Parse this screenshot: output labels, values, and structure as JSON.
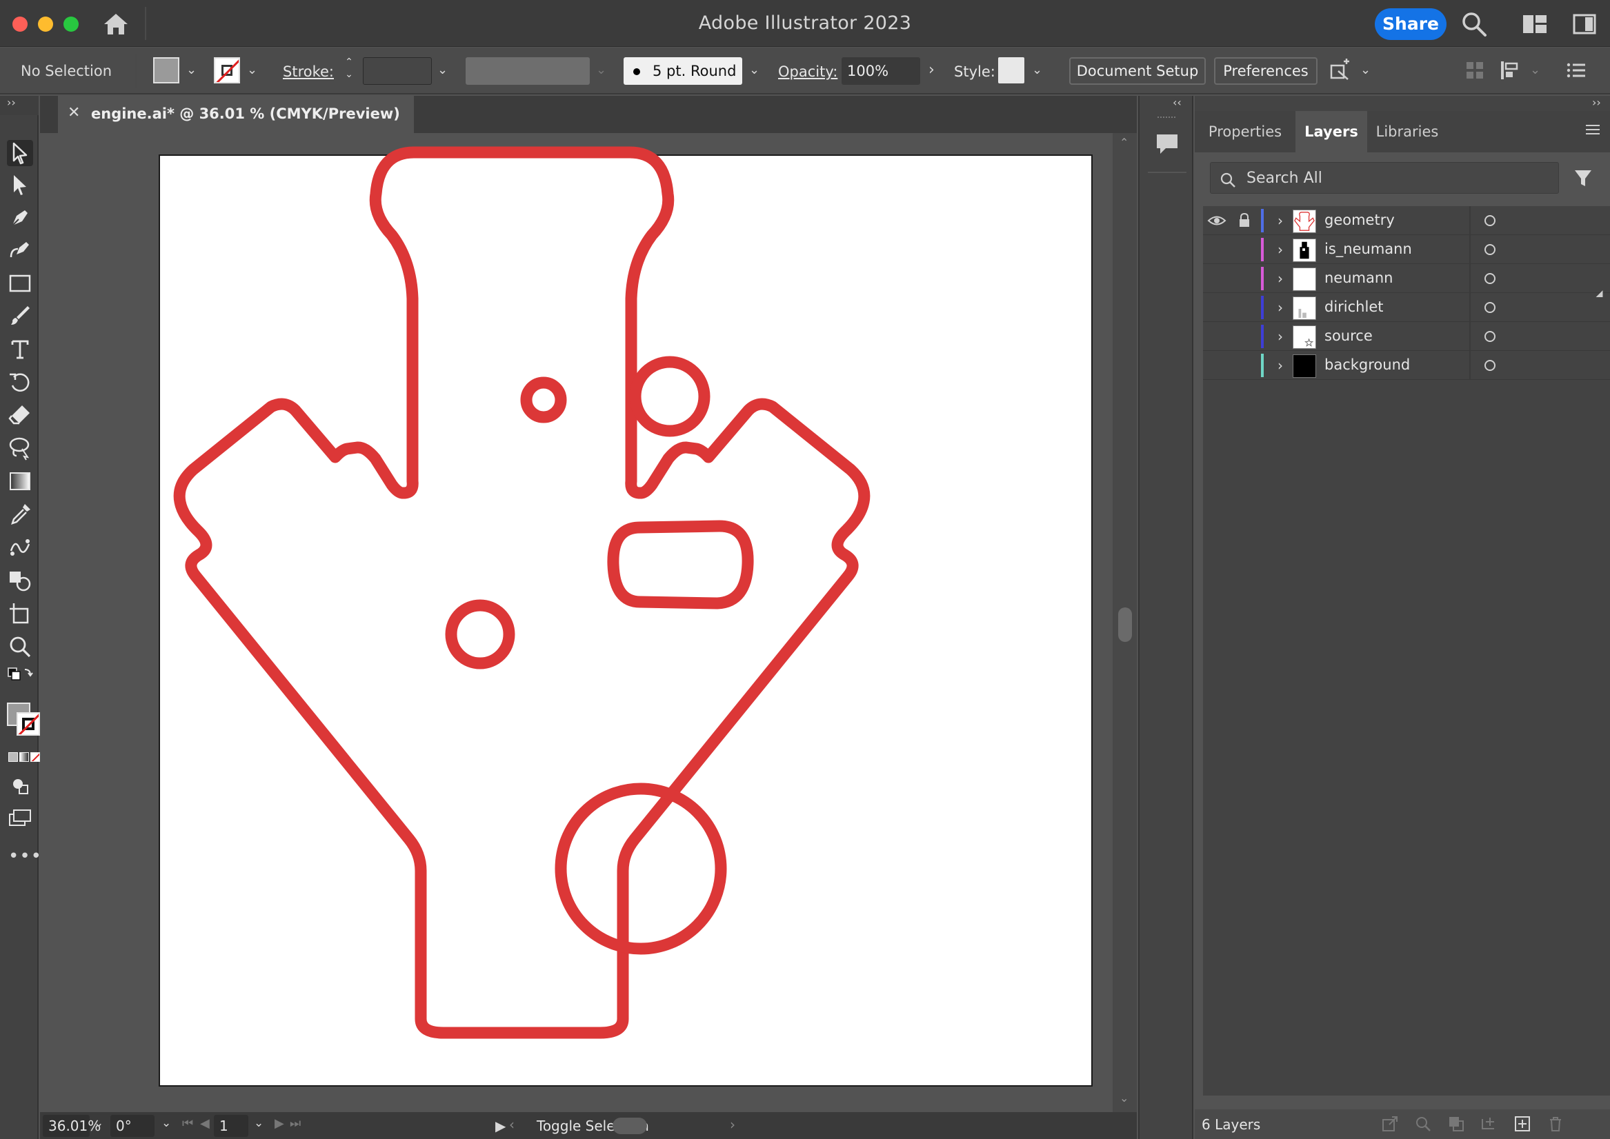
{
  "app": {
    "title": "Adobe Illustrator 2023",
    "share_label": "Share"
  },
  "control_bar": {
    "selection_status": "No Selection",
    "stroke_label": "Stroke:",
    "brush_label": "5 pt. Round",
    "opacity_label": "Opacity:",
    "opacity_value": "100%",
    "style_label": "Style:",
    "document_setup_label": "Document Setup",
    "preferences_label": "Preferences"
  },
  "document": {
    "tab_title": "engine.ai* @ 36.01 % (CMYK/Preview)",
    "shape_stroke_color": "#dc3737"
  },
  "status_bar": {
    "zoom": "36.01%",
    "rotation": "0°",
    "artboard_number": "1",
    "toggle_label": "Toggle Selection"
  },
  "panel": {
    "tabs": [
      {
        "label": "Properties",
        "active": false
      },
      {
        "label": "Layers",
        "active": true
      },
      {
        "label": "Libraries",
        "active": false
      }
    ],
    "search_placeholder": "Search All",
    "layers": [
      {
        "name": "geometry",
        "color": "#4f6ee6"
      },
      {
        "name": "is_neumann",
        "color": "#d85ad8"
      },
      {
        "name": "neumann",
        "color": "#d85ad8"
      },
      {
        "name": "dirichlet",
        "color": "#3e3ed6"
      },
      {
        "name": "source",
        "color": "#3e3ed6"
      },
      {
        "name": "background",
        "color": "#6fd6c6"
      }
    ],
    "layers_count": "6 Layers"
  },
  "colors": {
    "accent": "#1473e6",
    "ui_background": "#535353"
  }
}
